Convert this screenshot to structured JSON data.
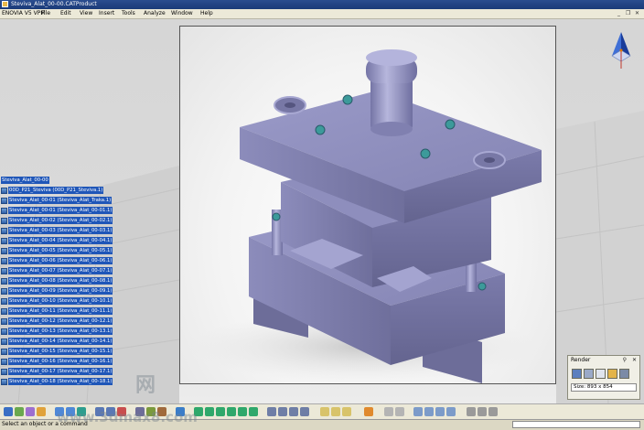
{
  "window": {
    "title": "Steviva_Alat_00-00.CATProduct"
  },
  "menu": [
    "ENOVIA V5 VPM",
    "File",
    "Edit",
    "View",
    "Insert",
    "Tools",
    "Analyze",
    "Window",
    "Help"
  ],
  "tree": {
    "root": "Steviva_Alat_00-00",
    "nodes": [
      "00D_P21_Steviva (00D_P21_Steviva.1)",
      "Steviva_Alat_00-01 (Steviva_Alat_Traka.1)",
      "Steviva_Alat_00-01 (Steviva_Alat_00-01.1)",
      "Steviva_Alat_00-02 (Steviva_Alat_00-02.1)",
      "Steviva_Alat_00-03 (Steviva_Alat_00-03.1)",
      "Steviva_Alat_00-04 (Steviva_Alat_00-04.1)",
      "Steviva_Alat_00-05 (Steviva_Alat_00-05.1)",
      "Steviva_Alat_00-06 (Steviva_Alat_00-06.1)",
      "Steviva_Alat_00-07 (Steviva_Alat_00-07.1)",
      "Steviva_Alat_00-08 (Steviva_Alat_00-08.1)",
      "Steviva_Alat_00-09 (Steviva_Alat_00-09.1)",
      "Steviva_Alat_00-10 (Steviva_Alat_00-10.1)",
      "Steviva_Alat_00-11 (Steviva_Alat_00-11.1)",
      "Steviva_Alat_00-12 (Steviva_Alat_00-12.1)",
      "Steviva_Alat_00-13 (Steviva_Alat_00-13.1)",
      "Steviva_Alat_00-14 (Steviva_Alat_00-14.1)",
      "Steviva_Alat_00-15 (Steviva_Alat_00-15.1)",
      "Steviva_Alat_00-16 (Steviva_Alat_00-16.1)",
      "Steviva_Alat_00-17 (Steviva_Alat_00-17.1)",
      "Steviva_Alat_00-18 (Steviva_Alat_00-18.1)"
    ]
  },
  "render_panel": {
    "title": "Render",
    "size_label": "Size: 893 x 854"
  },
  "status": {
    "text": "Select an object or a command"
  },
  "watermark": {
    "site": "www.3dmax8.com",
    "glyph": "网"
  }
}
